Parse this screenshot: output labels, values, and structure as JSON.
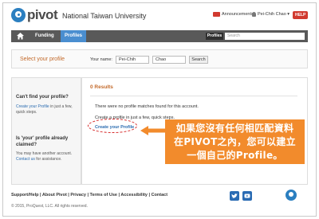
{
  "header": {
    "logo_text": "pivot",
    "institution": "National Taiwan University",
    "announcements_label": "Announcements",
    "user_name": "Pei-Chih Chao",
    "help_label": "HELP"
  },
  "nav": {
    "funding_label": "Funding",
    "profiles_label": "Profiles",
    "profiles_tab_label": "Profiles",
    "search_placeholder": "Search"
  },
  "select_profile": {
    "title": "Select your profile",
    "your_name_label": "Your name:",
    "first_name_value": "Pei-Chih",
    "last_name_value": "Chao",
    "search_button": "Search"
  },
  "sidebar": {
    "cant_find_heading": "Can't find your profile?",
    "create_link": "Create your Profile",
    "create_rest": " in just a few, quick steps.",
    "claimed_heading": "Is 'your' profile already claimed?",
    "claimed_text": "You may have another account.",
    "contact_link": "Contact us",
    "contact_rest": " for assistance."
  },
  "main": {
    "results_label": "0 Results",
    "no_match_text": "There were no profile matches found for this account.",
    "create_text": "Create a profile in just a few, quick steps.",
    "create_link": "Create your Profile"
  },
  "callout": {
    "line1": "如果您沒有任何相匹配資料",
    "line2": "在PIVOT之內，您可以建立",
    "line3": "一個自己的Profile。"
  },
  "footer": {
    "links": "Support/Help | About Pivot | Privacy | Terms of Use | Accessibility | Contact",
    "copyright": "© 2015, ProQuest, LLC. All rights reserved."
  },
  "colors": {
    "accent_orange": "#f28b2c",
    "nav_gray": "#595959",
    "nav_active_blue": "#4a8ed0",
    "link_blue": "#2b6cb0",
    "help_red": "#d13a2f"
  }
}
